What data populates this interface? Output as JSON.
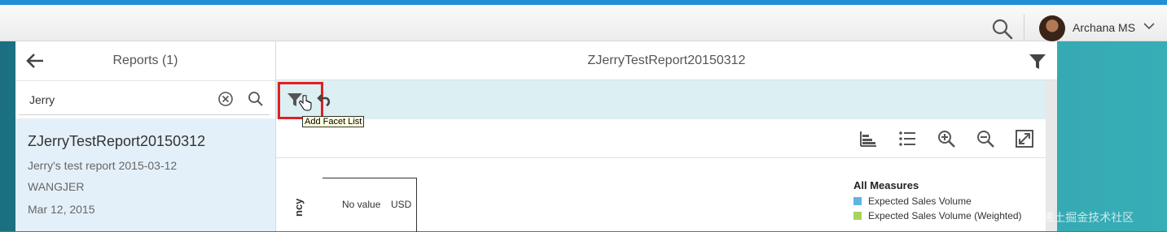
{
  "shell": {
    "user_name": "Archana MS"
  },
  "master": {
    "title": "Reports (1)",
    "search_value": "Jerry",
    "items": [
      {
        "title": "ZJerryTestReport20150312",
        "description": "Jerry's test report 2015-03-12",
        "owner": "WANGJER",
        "date": "Mar 12, 2015"
      }
    ]
  },
  "detail": {
    "title": "ZJerryTestReport20150312",
    "tooltip": "Add Facet List"
  },
  "chart": {
    "no_value": "No value",
    "currency": "USD",
    "y_axis_partial": "ncy"
  },
  "chart_data": {
    "type": "bar",
    "categories": [
      "No value"
    ],
    "series": [
      {
        "name": "Expected Sales Volume",
        "values": [
          0
        ]
      },
      {
        "name": "Expected Sales Volume (Weighted)",
        "values": [
          0
        ]
      }
    ],
    "legend_title": "All Measures",
    "colors": [
      "#5db4e6",
      "#a8d35a"
    ]
  },
  "legend": {
    "title": "All Measures",
    "items": [
      {
        "label": "Expected Sales Volume",
        "color": "#5db4e6"
      },
      {
        "label": "Expected Sales Volume (Weighted)",
        "color": "#a8d35a"
      }
    ]
  },
  "watermark": "@稀土掘金技术社区",
  "icons": {
    "shell_search": "search-icon",
    "user_menu": "chevron-down-icon",
    "back": "arrow-left-icon",
    "clear": "clear-icon",
    "search": "search-icon",
    "filter": "filter-icon",
    "undo": "undo-icon",
    "chart_tools": [
      "bar-chart-icon",
      "list-icon",
      "zoom-in-icon",
      "zoom-out-icon",
      "fullscreen-icon"
    ]
  }
}
